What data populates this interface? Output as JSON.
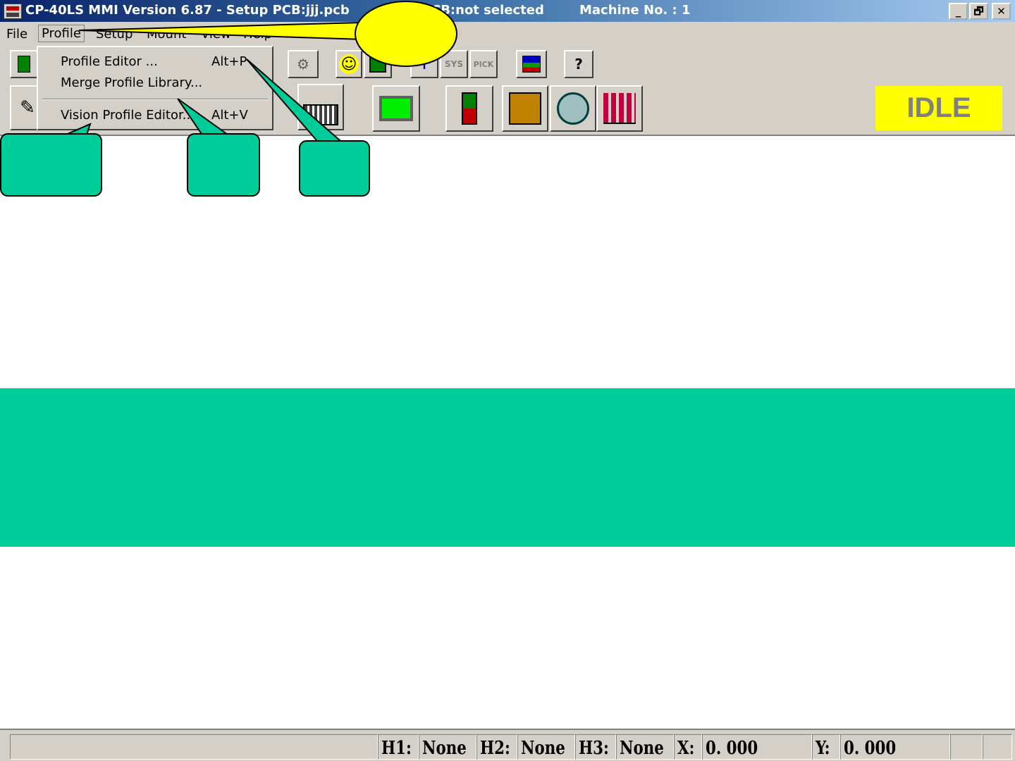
{
  "titlebar": {
    "title": "CP-40LS MMI Version 6.87 - Setup PCB:jjj.pcb",
    "pcb_status": "CB:not selected",
    "machine": "Machine No. : 1",
    "minimize": "_",
    "restore": "🗗",
    "close": "✕"
  },
  "menubar": {
    "file": "File",
    "profile": "Profile",
    "setup": "Setup",
    "mount": "Mount",
    "view": "View",
    "help": "Help"
  },
  "profile_menu": {
    "profile_editor": "Profile Editor ...",
    "profile_editor_shortcut": "Alt+P",
    "merge_library": "Merge Profile Library...",
    "vision_editor": "Vision Profile Editor...",
    "vision_editor_shortcut": "Alt+V"
  },
  "toolbar": {
    "sys_label": "SYS",
    "pick_label": "PICK",
    "help_glyph": "?",
    "smile_glyph": "☺"
  },
  "status": {
    "state": "IDLE"
  },
  "statusbar": {
    "h1_label": "H1:",
    "h1_value": "None",
    "h2_label": "H2:",
    "h2_value": "None",
    "h3_label": "H3:",
    "h3_value": "None",
    "x_label": "X:",
    "x_value": "0. 000",
    "y_label": "Y:",
    "y_value": "0. 000"
  },
  "colors": {
    "callout_yellow": "#ffff00",
    "callout_teal": "#00cc99",
    "band": "#00cc99",
    "idle_bg": "#ffff00"
  }
}
